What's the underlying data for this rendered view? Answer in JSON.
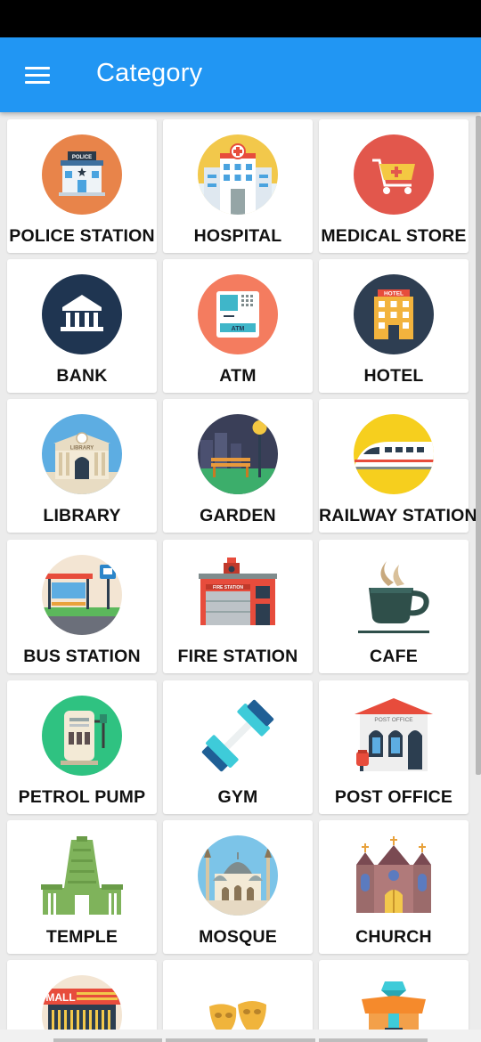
{
  "app_bar": {
    "title": "Category",
    "color": "#2196f3"
  },
  "categories": [
    {
      "label": "POLICE STATION",
      "icon": "police-station-icon"
    },
    {
      "label": "HOSPITAL",
      "icon": "hospital-icon"
    },
    {
      "label": "MEDICAL STORE",
      "icon": "medical-store-icon"
    },
    {
      "label": "BANK",
      "icon": "bank-icon"
    },
    {
      "label": "ATM",
      "icon": "atm-icon"
    },
    {
      "label": "HOTEL",
      "icon": "hotel-icon"
    },
    {
      "label": "LIBRARY",
      "icon": "library-icon"
    },
    {
      "label": "GARDEN",
      "icon": "garden-icon"
    },
    {
      "label": "RAILWAY STATION",
      "icon": "railway-station-icon"
    },
    {
      "label": "BUS STATION",
      "icon": "bus-station-icon"
    },
    {
      "label": "FIRE STATION",
      "icon": "fire-station-icon"
    },
    {
      "label": "CAFE",
      "icon": "cafe-icon"
    },
    {
      "label": "PETROL PUMP",
      "icon": "petrol-pump-icon"
    },
    {
      "label": "GYM",
      "icon": "gym-icon"
    },
    {
      "label": "POST OFFICE",
      "icon": "post-office-icon"
    },
    {
      "label": "TEMPLE",
      "icon": "temple-icon"
    },
    {
      "label": "MOSQUE",
      "icon": "mosque-icon"
    },
    {
      "label": "CHURCH",
      "icon": "church-icon"
    },
    {
      "label": "",
      "icon": "mall-icon"
    },
    {
      "label": "",
      "icon": "theatre-icon"
    },
    {
      "label": "",
      "icon": "gift-shop-icon"
    }
  ],
  "icon_text": {
    "police": "POLICE",
    "atm": "ATM",
    "hotel": "HOTEL",
    "library": "LIBRARY",
    "fire_station": "FIRE STATION",
    "post_office": "POST OFFICE",
    "mall": "MALL"
  }
}
